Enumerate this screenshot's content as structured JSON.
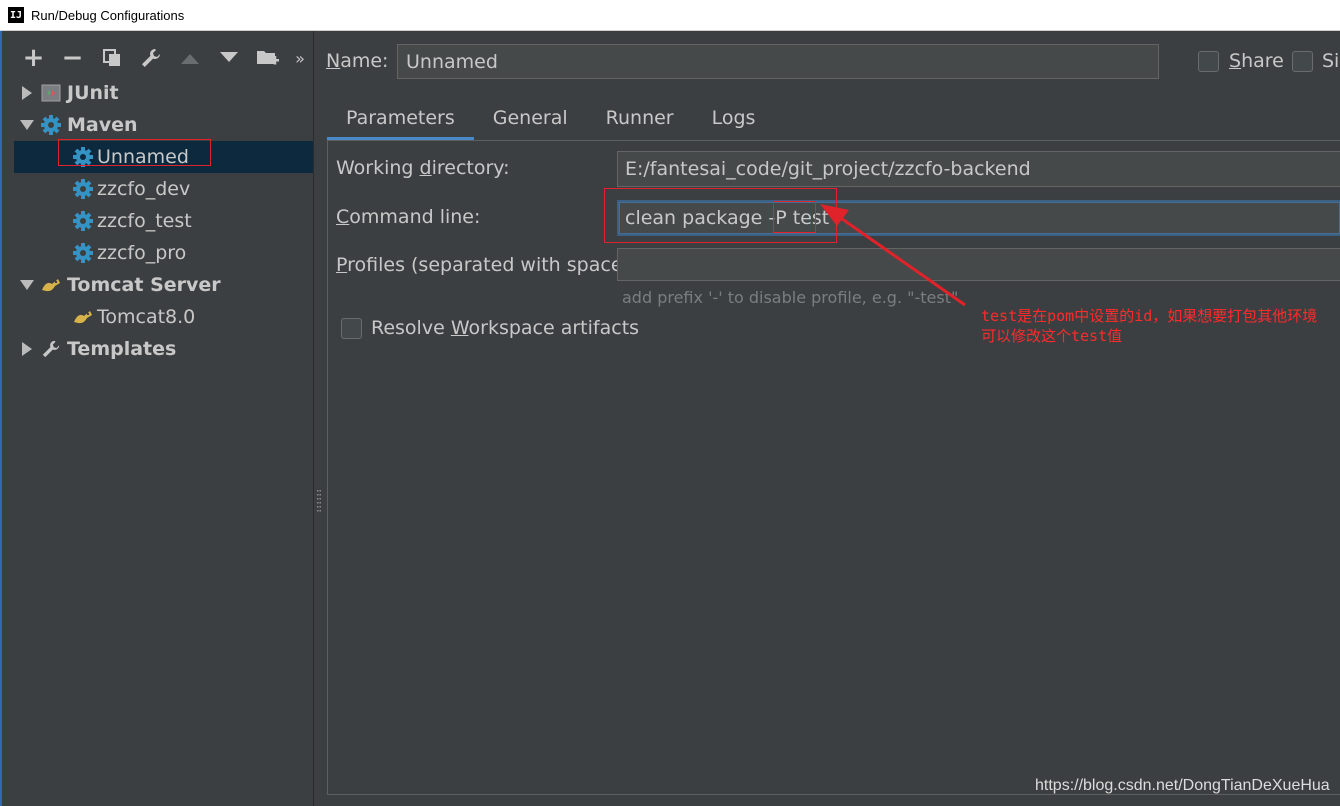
{
  "window": {
    "title": "Run/Debug Configurations",
    "app_icon_letter": "IJ"
  },
  "toolbar": {
    "add": "+",
    "remove": "−",
    "more": "»"
  },
  "tree": {
    "junit": "JUnit",
    "maven": "Maven",
    "maven_items": [
      "Unnamed",
      "zzcfo_dev",
      "zzcfo_test",
      "zzcfo_pro"
    ],
    "tomcat": "Tomcat Server",
    "tomcat_items": [
      "Tomcat8.0"
    ],
    "templates": "Templates"
  },
  "header": {
    "name_mnemonic": "N",
    "name_rest": "ame:",
    "name_value": "Unnamed",
    "share_mnemonic": "S",
    "share_rest": "hare",
    "single_label": "Si"
  },
  "tabs": [
    "Parameters",
    "General",
    "Runner",
    "Logs"
  ],
  "params": {
    "working_dir_pre": "Working ",
    "working_dir_mn": "d",
    "working_dir_post": "irectory:",
    "working_dir_value": "E:/fantesai_code/git_project/zzcfo-backend",
    "command_mn": "C",
    "command_post": "ommand line:",
    "command_prefix": "clean package -P ",
    "command_profile": "test",
    "profiles_mn": "P",
    "profiles_post": "rofiles (separated with space):",
    "profiles_value": "",
    "hint": "add prefix '-' to disable profile, e.g. \"-test\"",
    "resolve_pre": "Resolve ",
    "resolve_mn": "W",
    "resolve_post": "orkspace artifacts"
  },
  "annotation": {
    "line1": "test是在pom中设置的id，如果想要打包其他环境",
    "line2": "可以修改这个test值"
  },
  "watermark": "https://blog.csdn.net/DongTianDeXueHua",
  "colors": {
    "accent": "#4a88c7",
    "annotation_red": "#e0222a",
    "selection": "#0d293e",
    "maven_gear": "#3592c4"
  }
}
